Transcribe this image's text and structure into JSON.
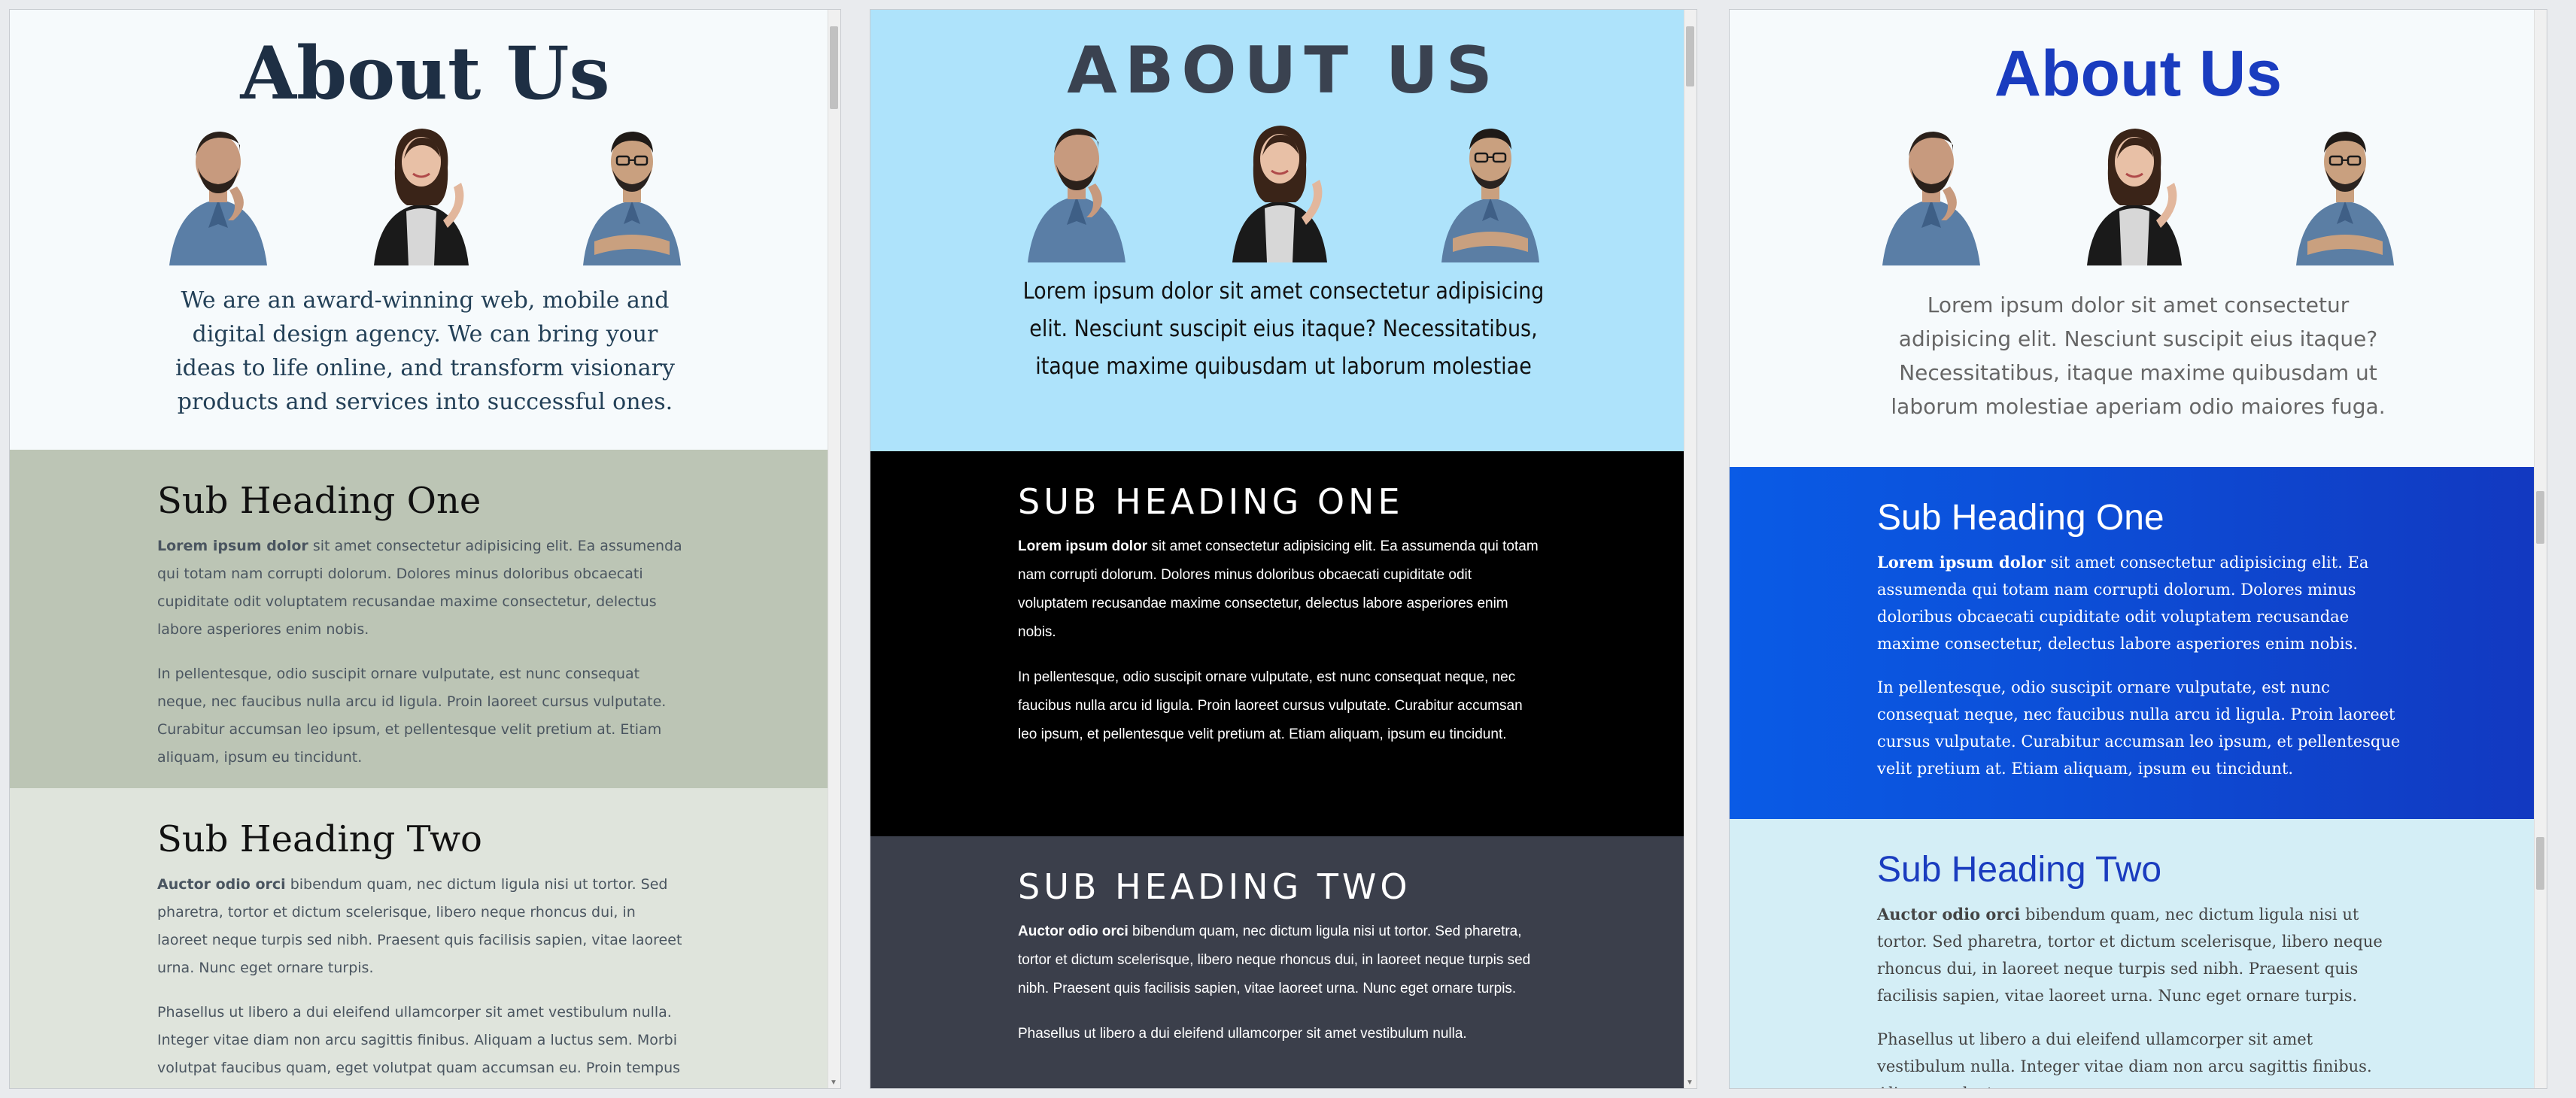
{
  "panels": [
    {
      "title": "About Us",
      "intro": "We are an award-winning web, mobile and digital design agency. We can bring your ideas to life online, and transform visionary products and services into successful ones.",
      "sections": [
        {
          "heading": "Sub Heading One",
          "lead": "Lorem ipsum dolor",
          "p1": " sit amet consectetur adipisicing elit. Ea assumenda qui totam nam corrupti dolorum. Dolores minus doloribus obcaecati cupiditate odit voluptatem recusandae maxime consectetur, delectus labore asperiores enim nobis.",
          "p2": "In pellentesque, odio suscipit ornare vulputate, est nunc consequat neque, nec faucibus nulla arcu id ligula. Proin laoreet cursus vulputate. Curabitur accumsan leo ipsum, et pellentesque velit pretium at. Etiam aliquam, ipsum eu tincidunt."
        },
        {
          "heading": "Sub Heading Two",
          "lead": "Auctor odio orci",
          "p1": " bibendum quam, nec dictum ligula nisi ut tortor. Sed pharetra, tortor et dictum scelerisque, libero neque rhoncus dui, in laoreet neque turpis sed nibh. Praesent quis facilisis sapien, vitae laoreet urna. Nunc eget ornare turpis.",
          "p2": "Phasellus ut libero a dui eleifend ullamcorper sit amet vestibulum nulla. Integer vitae diam non arcu sagittis finibus. Aliquam a luctus sem. Morbi volutpat faucibus quam, eget volutpat quam accumsan eu. Proin tempus"
        }
      ]
    },
    {
      "title": "ABOUT US",
      "intro": "Lorem ipsum dolor sit amet consectetur adipisicing elit. Nesciunt suscipit eius itaque? Necessitatibus, itaque maxime quibusdam ut laborum molestiae",
      "sections": [
        {
          "heading": "SUB HEADING ONE",
          "lead": "Lorem ipsum dolor",
          "p1": " sit amet consectetur adipisicing elit. Ea assumenda qui totam nam corrupti dolorum. Dolores minus doloribus obcaecati cupiditate odit voluptatem recusandae maxime consectetur, delectus labore asperiores enim nobis.",
          "p2": "In pellentesque, odio suscipit ornare vulputate, est nunc consequat neque, nec faucibus nulla arcu id ligula. Proin laoreet cursus vulputate. Curabitur accumsan leo ipsum, et pellentesque velit pretium at. Etiam aliquam, ipsum eu tincidunt."
        },
        {
          "heading": "SUB HEADING TWO",
          "lead": "Auctor odio orci",
          "p1": " bibendum quam, nec dictum ligula nisi ut tortor. Sed pharetra, tortor et dictum scelerisque, libero neque rhoncus dui, in laoreet neque turpis sed nibh. Praesent quis facilisis sapien, vitae laoreet urna. Nunc eget ornare turpis.",
          "p2": "Phasellus ut libero a dui eleifend ullamcorper sit amet vestibulum nulla."
        }
      ]
    },
    {
      "title": "About Us",
      "intro": "Lorem ipsum dolor sit amet consectetur adipisicing elit. Nesciunt suscipit eius itaque? Necessitatibus, itaque maxime quibusdam ut laborum molestiae aperiam odio maiores fuga.",
      "sections": [
        {
          "heading": "Sub Heading One",
          "lead": "Lorem ipsum dolor",
          "p1": " sit amet consectetur adipisicing elit. Ea assumenda qui totam nam corrupti dolorum. Dolores minus doloribus obcaecati cupiditate odit voluptatem recusandae maxime consectetur, delectus labore asperiores enim nobis.",
          "p2": "In pellentesque, odio suscipit ornare vulputate, est nunc consequat neque, nec faucibus nulla arcu id ligula. Proin laoreet cursus vulputate. Curabitur accumsan leo ipsum, et pellentesque velit pretium at. Etiam aliquam, ipsum eu tincidunt."
        },
        {
          "heading": "Sub Heading Two",
          "lead": "Auctor odio orci",
          "p1": " bibendum quam, nec dictum ligula nisi ut tortor. Sed pharetra, tortor et dictum scelerisque, libero neque rhoncus dui, in laoreet neque turpis sed nibh. Praesent quis facilisis sapien, vitae laoreet urna. Nunc eget ornare turpis.",
          "p2": "Phasellus ut libero a dui eleifend ullamcorper sit amet vestibulum nulla. Integer vitae diam non arcu sagittis finibus. Aliquam a luctus"
        }
      ]
    }
  ],
  "team_photos": [
    "man-beard-thinking-photo",
    "woman-smiling-photo",
    "man-glasses-arms-crossed-photo"
  ],
  "colors": {
    "p1_sec1": "#bcc5b5",
    "p1_sec2": "#dfe4dc",
    "p2_hero": "#aee3fb",
    "p2_sec1": "#000000",
    "p2_sec2": "#3b3f4b",
    "p3_title": "#1a3cbf",
    "p3_sec1": "#0c4fd8",
    "p3_sec2": "#d4eef6"
  }
}
